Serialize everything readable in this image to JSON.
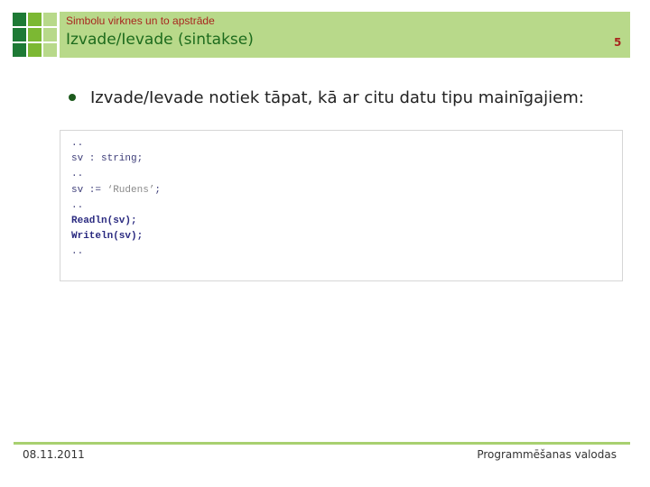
{
  "header": {
    "subtitle": "Simbolu virknes un to apstrāde",
    "title": "Izvade/Ievade (sintakse)",
    "page_number": "5"
  },
  "colors": {
    "dark_green": "#1e7a35",
    "mid_green": "#7cb833",
    "light_green": "#b8d98a",
    "accent_red": "#a8261e"
  },
  "body": {
    "bullet": "Izvade/Ievade notiek tāpat, kā ar citu datu tipu mainīgajiem:",
    "code": {
      "l1": "..",
      "l2": "sv : string;",
      "l3": "..",
      "l4a": "sv := ",
      "l4b": "‘Rudens’",
      "l4c": ";",
      "l5": "..",
      "l6": "Readln(sv);",
      "l7": "Writeln(sv);",
      "l8": ".."
    }
  },
  "footer": {
    "date": "08.11.2011",
    "course": "Programmēšanas valodas"
  }
}
